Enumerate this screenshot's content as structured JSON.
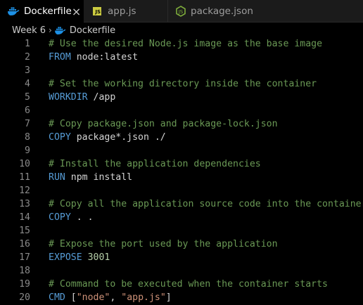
{
  "tabs": [
    {
      "label": "Dockerfile",
      "icon": "docker-icon",
      "active": true,
      "close": "×"
    },
    {
      "label": "app.js",
      "icon": "js-icon",
      "icon_text": "JS"
    },
    {
      "label": "package.json",
      "icon": "node-icon"
    }
  ],
  "breadcrumb": {
    "folder": "Week 6",
    "separator": "›",
    "file": "Dockerfile"
  },
  "colors": {
    "comment": "#6a9955",
    "keyword": "#569cd6",
    "text": "#d4d4d4",
    "string": "#ce9178",
    "number": "#b5cea8",
    "docker": "#1d91e6",
    "js": "#cbcb41",
    "node": "#7dab3b"
  },
  "lines": [
    {
      "num": "1",
      "comment": "# Use the desired Node.js image as the base image"
    },
    {
      "num": "2",
      "kw": "FROM",
      "text": " node:latest"
    },
    {
      "num": "3"
    },
    {
      "num": "4",
      "comment": "# Set the working directory inside the container"
    },
    {
      "num": "5",
      "kw": "WORKDIR",
      "text": " /app"
    },
    {
      "num": "6"
    },
    {
      "num": "7",
      "comment": "# Copy package.json and package-lock.json"
    },
    {
      "num": "8",
      "kw": "COPY",
      "text": " package*.json ./"
    },
    {
      "num": "9"
    },
    {
      "num": "10",
      "comment": "# Install the application dependencies"
    },
    {
      "num": "11",
      "kw": "RUN",
      "text": " npm install"
    },
    {
      "num": "12"
    },
    {
      "num": "13",
      "comment": "# Copy all the application source code into the container"
    },
    {
      "num": "14",
      "kw": "COPY",
      "text": " . ."
    },
    {
      "num": "15"
    },
    {
      "num": "16",
      "comment": "# Expose the port used by the application"
    },
    {
      "num": "17",
      "kw": "EXPOSE",
      "text": " ",
      "num_val": "3001"
    },
    {
      "num": "18"
    },
    {
      "num": "19",
      "comment": "# Command to be executed when the container starts"
    },
    {
      "num": "20",
      "kw": "CMD",
      "text": " [",
      "str1": "\"node\"",
      "text2": ", ",
      "str2": "\"app.js\"",
      "text3": "]"
    }
  ]
}
